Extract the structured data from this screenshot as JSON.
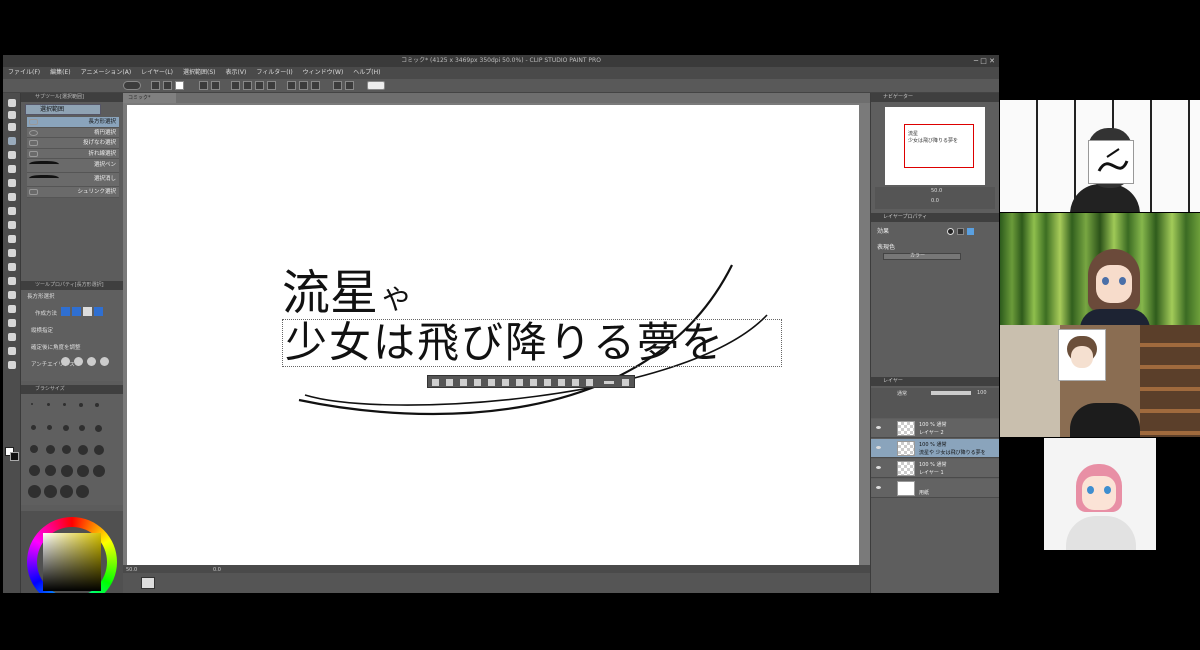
{
  "window": {
    "title": "コミック* (4125 x 3469px 350dpi 50.0%) - CLIP STUDIO PAINT PRO",
    "controls": "─ □ ✕"
  },
  "menu": [
    "ファイル(F)",
    "編集(E)",
    "アニメーション(A)",
    "レイヤー(L)",
    "選択範囲(S)",
    "表示(V)",
    "フィルター(I)",
    "ウィンドウ(W)",
    "ヘルプ(H)"
  ],
  "left_panel": {
    "subtool_header": "サブツール[選択範囲]",
    "subtool_tab": "選択範囲",
    "subtools": [
      "長方形選択",
      "楕円選択",
      "投げなわ選択",
      "折れ線選択",
      "選択ペン",
      "選択消し",
      "シュリンク選択"
    ],
    "tool_property_header": "ツールプロパティ[長方形選択]",
    "tool_property_title": "長方形選択",
    "creation_method_label": "作成方法",
    "aspect_label": "縦横指定",
    "angle_label": "確定後に角度を調整",
    "antialias_label": "アンチエイリアス",
    "brush_size_header": "ブラシサイズ",
    "brush_sizes": [
      "0.7",
      "1",
      "1.5",
      "2",
      "2.5",
      "3",
      "4",
      "5",
      "6",
      "7",
      "8",
      "10",
      "12",
      "15",
      "17",
      "20",
      "25",
      "30",
      "40",
      "50",
      "60",
      "70",
      "80",
      "100"
    ]
  },
  "canvas": {
    "tab_label": "コミック*",
    "title_big": "流星",
    "title_small": "や",
    "subtitle": "少女は飛び降りる夢を",
    "zoom": "50.0",
    "status_extra": "0.0"
  },
  "right_panel": {
    "navigator_header": "ナビゲーター",
    "navigator_zoom": "50.0",
    "navigator_angle": "0.0",
    "layer_property_header": "レイヤープロパティ",
    "effect_label": "効果",
    "expression_color_label": "表現色",
    "color_value": "カラー",
    "layer_header": "レイヤー",
    "blend_mode": "通常",
    "opacity": "100",
    "layers": [
      {
        "line1": "100 % 通常",
        "line2": "レイヤー 2",
        "selected": false
      },
      {
        "line1": "100 % 通常",
        "line2": "流星や 少女は飛び降りる夢を",
        "selected": true
      },
      {
        "line1": "100 % 通常",
        "line2": "レイヤー 1",
        "selected": false
      },
      {
        "line1": "",
        "line2": "用紙",
        "selected": false
      }
    ]
  },
  "participants": [
    {
      "tile": "camera-1"
    },
    {
      "tile": "camera-2"
    },
    {
      "tile": "camera-3"
    },
    {
      "tile": "camera-4"
    }
  ],
  "colors": {
    "selection_blue": "#8aa4bc",
    "app_gray": "#6e6e6e",
    "frame_red": "#dd0000"
  }
}
